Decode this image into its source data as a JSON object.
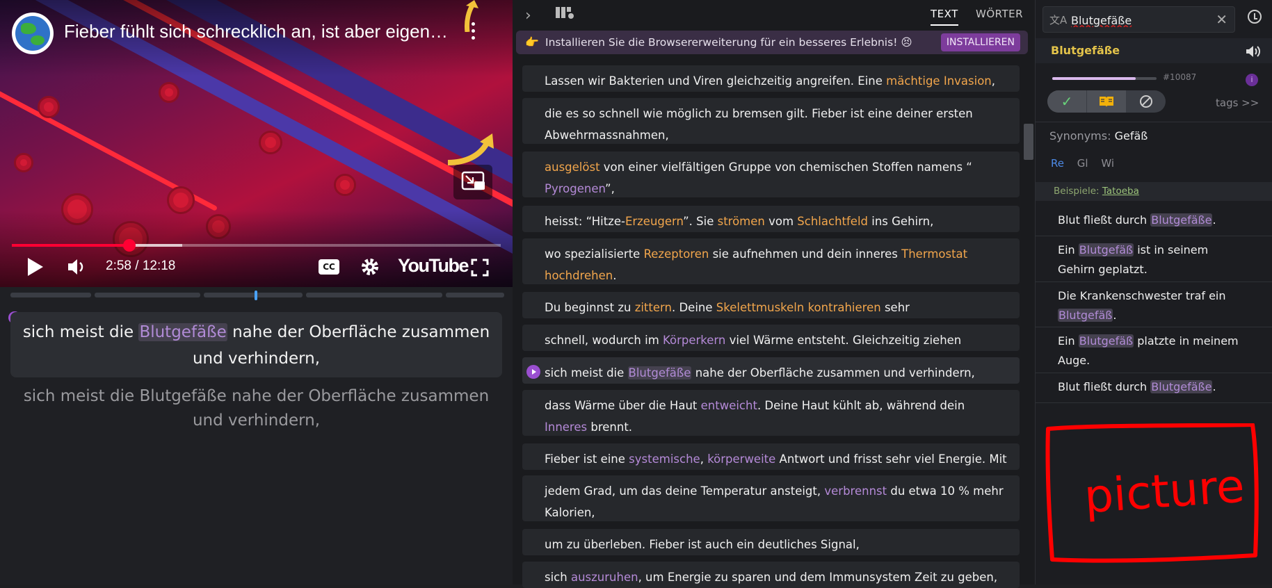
{
  "video": {
    "title": "Fieber fühlt sich schrecklich an, ist aber eigen…",
    "time": "2:58 / 12:18",
    "progress_fraction": 0.241,
    "buffer_fraction": 0.349,
    "cc_label": "CC",
    "brand": "YouTube"
  },
  "subtitle": {
    "line_before": "sich meist die ",
    "highlight": "Blutgefäße",
    "line_after": " nahe der Oberfläche zusammen",
    "line2": "und verhindern,",
    "translation": "sich meist die Blutgefäße nahe der Oberfläche zusammen und verhindern,"
  },
  "text_panel": {
    "tabs": [
      "TEXT",
      "WÖRTER"
    ],
    "banner": {
      "icon": "👉",
      "message": "Installieren Sie die Browsererweiterung für ein besseres Erlebnis! 😣",
      "button": "INSTALLIEREN"
    },
    "segments": [
      {
        "parts": [
          [
            "Lassen wir Bakterien und Viren gleichzeitig angreifen. Eine ",
            ""
          ],
          [
            "mächtige",
            "o"
          ],
          [
            " ",
            ""
          ],
          [
            "Invasion",
            "o"
          ],
          [
            ",",
            ""
          ]
        ]
      },
      {
        "parts": [
          [
            "die es so schnell wie möglich zu bremsen gilt. Fieber ist eine deiner ersten",
            ""
          ]
        ],
        "line2": [
          [
            "Abwehrmassnahmen,",
            ""
          ]
        ]
      },
      {
        "parts": [
          [
            "ausgelöst",
            "o"
          ],
          [
            " von einer vielfältigen Gruppe von chemischen Stoffen namens “",
            ""
          ]
        ],
        "line2": [
          [
            "Pyrogenen",
            "p"
          ],
          [
            "”,",
            ""
          ]
        ]
      },
      {
        "parts": [
          [
            "heisst: “Hitze-",
            ""
          ],
          [
            "Erzeugern",
            "o"
          ],
          [
            "”. Sie ",
            ""
          ],
          [
            "strömen",
            "o"
          ],
          [
            " vom ",
            ""
          ],
          [
            "Schlachtfeld",
            "o"
          ],
          [
            " ins Gehirn,",
            ""
          ]
        ]
      },
      {
        "parts": [
          [
            "wo spezialisierte ",
            ""
          ],
          [
            "Rezeptoren",
            "o"
          ],
          [
            " sie aufnehmen und dein inneres ",
            ""
          ],
          [
            "Thermostat",
            "o"
          ]
        ],
        "line2": [
          [
            "hochdrehen",
            "o"
          ],
          [
            ".",
            ""
          ]
        ]
      },
      {
        "parts": [
          [
            "Du beginnst zu ",
            ""
          ],
          [
            "zittern",
            "o"
          ],
          [
            ". Deine ",
            ""
          ],
          [
            "Skelettmuskeln",
            "o"
          ],
          [
            " ",
            ""
          ],
          [
            "kontrahieren",
            "o"
          ],
          [
            " sehr",
            ""
          ]
        ]
      },
      {
        "parts": [
          [
            "schnell, wodurch im ",
            ""
          ],
          [
            "Körperkern",
            "p"
          ],
          [
            " viel Wärme entsteht. Gleichzeitig ziehen",
            ""
          ]
        ]
      },
      {
        "parts": [
          [
            "sich meist die ",
            ""
          ],
          [
            "Blutgefäße",
            "hl"
          ],
          [
            " nahe der Oberfläche zusammen und verhindern,",
            ""
          ]
        ],
        "active": true
      },
      {
        "parts": [
          [
            "dass Wärme über die Haut ",
            ""
          ],
          [
            "entweicht",
            "p"
          ],
          [
            ". Deine Haut kühlt ab, während dein",
            ""
          ]
        ],
        "line2": [
          [
            "Inneres",
            "p"
          ],
          [
            " brennt.",
            ""
          ]
        ]
      },
      {
        "parts": [
          [
            "Fieber ist eine ",
            ""
          ],
          [
            "systemische",
            "p"
          ],
          [
            ", ",
            ""
          ],
          [
            "körperweite",
            "p"
          ],
          [
            " Antwort und frisst sehr viel Energie. Mit",
            ""
          ]
        ]
      },
      {
        "parts": [
          [
            "jedem Grad, um das deine Temperatur ansteigt, ",
            ""
          ],
          [
            "verbrennst",
            "p"
          ],
          [
            " du etwa 10 % mehr",
            ""
          ]
        ],
        "line2": [
          [
            "Kalorien,",
            ""
          ]
        ]
      },
      {
        "parts": [
          [
            "um zu überleben. Fieber ist auch ein deutliches Signal,",
            ""
          ]
        ]
      },
      {
        "parts": [
          [
            "sich ",
            ""
          ],
          [
            "auszuruhen",
            "p"
          ],
          [
            ", um Energie zu sparen und dem Immunsystem Zeit zu geben,",
            ""
          ]
        ]
      }
    ]
  },
  "dictionary": {
    "search_value": "Blutgefäße",
    "word": "Blutgefäße",
    "frequency_rank": "#10087",
    "frequency_fraction": 0.8,
    "info": "i",
    "tags_label": "tags >>",
    "synonyms_label": "Synonyms:",
    "synonyms_value": "Gefäß",
    "sources": [
      "Re",
      "Gl",
      "Wi"
    ],
    "examples_label": "Beispiele:",
    "examples_source": "Tatoeba",
    "examples": [
      {
        "before": "Blut fließt durch ",
        "hl": "Blutgefäße",
        "after": "."
      },
      {
        "before": "Ein ",
        "hl": "Blutgefäß",
        "after": " ist in seinem",
        "line2": "Gehirn geplatzt."
      },
      {
        "before": "Die Krankenschwester traf ein",
        "hl2": "Blutgefäß",
        "after2": "."
      },
      {
        "before": "Ein ",
        "hl": "Blutgefäß",
        "after": " platzte in meinem",
        "line2": "Auge."
      },
      {
        "before": "Blut fließt durch ",
        "hl": "Blutgefäße",
        "after": "."
      }
    ],
    "picture_label": "picture"
  },
  "colors": {
    "accent_purple": "#9a4fd0",
    "known_word": "#f2a64c",
    "learning_word": "#b58ad8",
    "youtube_red": "#ff0033",
    "picture_red": "#ff0000"
  }
}
